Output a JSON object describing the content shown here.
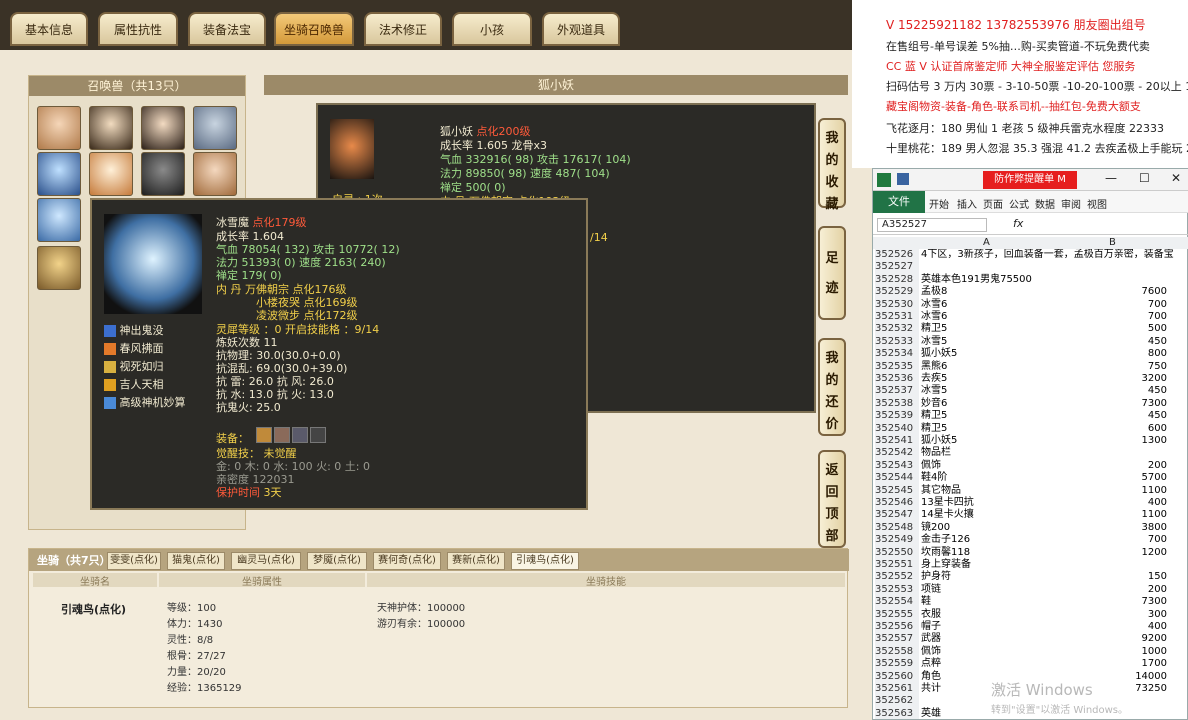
{
  "tabs": [
    {
      "label": "基本信息"
    },
    {
      "label": "属性抗性"
    },
    {
      "label": "装备法宝"
    },
    {
      "label": "坐骑召唤兽"
    },
    {
      "label": "法术修正"
    },
    {
      "label": "小孩"
    },
    {
      "label": "外观道具"
    }
  ],
  "pets_panel": {
    "title": "召唤兽（共13只）"
  },
  "detail_header": {
    "title": "狐小妖"
  },
  "back_card": {
    "name": "狐小妖",
    "name_tag": "点化200级",
    "growth": "成长率 1.605 龙骨x3",
    "hp": "气血 332916( 98) 攻击 17617( 104)",
    "mp": "法力 89850( 98) 速度 487( 104)",
    "ding": "禅定 500( 0)",
    "partial1": "启灵 : 1次",
    "partial2": "内  丹 万佛朝宗 点化192级",
    "partial3": "/14"
  },
  "front_card": {
    "name": "冰雪魔",
    "name_tag": "点化179级",
    "growth": "成长率 1.604",
    "hp": "气血 78054( 132) 攻击 10772( 12)",
    "mp": "法力 51393( 0) 速度 2163( 240)",
    "ding": "禅定 179( 0)",
    "neidan1": "内    丹 万佛朝宗 点化176级",
    "neidan2": "小楼夜哭 点化169级",
    "neidan3": "凌波微步 点化172级",
    "skills": [
      {
        "name": "神出鬼没"
      },
      {
        "name": "春风拂面"
      },
      {
        "name": "视死如归"
      },
      {
        "name": "吉人天相"
      },
      {
        "name": "高级神机妙算"
      }
    ],
    "lingxi": "灵犀等级 ：0 开启技能格 ：9/14",
    "lianyao": "炼妖次数 11",
    "resist1": "抗物理: 30.0(30.0+0.0)",
    "resist2": "抗混乱: 69.0(30.0+39.0)",
    "resist3": "抗    雷: 26.0 抗    风: 26.0",
    "resist4": "抗    水: 13.0 抗    火: 13.0",
    "resist5": "抗鬼火: 25.0",
    "equip_label": "装备：",
    "awake": "觉醒技：  未觉醒",
    "elements": "金: 0 木: 0 水: 100 火: 0 土: 0",
    "intimacy": "亲密度 122031",
    "protect_label": "保护时间",
    "protect_value": "3天"
  },
  "side_buttons": [
    {
      "label": "我的收藏"
    },
    {
      "label": "足迹"
    },
    {
      "label": "我的还价"
    },
    {
      "label": "返回顶部"
    }
  ],
  "mount": {
    "section_label": "坐骑（共7只）",
    "tabs": [
      {
        "label": "雯雯(点化)"
      },
      {
        "label": "猫鬼(点化)"
      },
      {
        "label": "幽灵马(点化)"
      },
      {
        "label": "梦魇(点化)"
      },
      {
        "label": "赛何奇(点化)"
      },
      {
        "label": "赛新(点化)"
      },
      {
        "label": "引魂鸟(点化)"
      }
    ],
    "col_name": "坐骑名",
    "col_attr": "坐骑属性",
    "col_skill": "坐骑技能",
    "name": "引魂鸟(点化)",
    "attrs": [
      {
        "text": "等级：100"
      },
      {
        "text": "体力：1430"
      },
      {
        "text": "灵性：8/8"
      },
      {
        "text": "根骨：27/27"
      },
      {
        "text": "力量：20/20"
      },
      {
        "text": "经验：1365129"
      }
    ],
    "skills": [
      {
        "text": "天神护体：100000"
      },
      {
        "text": "游刃有余：100000"
      }
    ]
  },
  "notepad": {
    "lines": [
      {
        "text": "V 15225921182   13782553976 朋友圈出组号",
        "color": "#e02020"
      },
      {
        "text": "在售组号-单号误差 5%抽…购-买卖管道-不玩免费代卖",
        "color": "#222"
      },
      {
        "text": "CC 蓝 V 认证首席鉴定师 大神全服鉴定评估 您服务",
        "color": "#e02020"
      },
      {
        "text": "扫码估号 3 万内 30票 - 3-10-50票  -10-20-100票 - 20以上 15",
        "color": "#222"
      },
      {
        "text": "藏宝阁物资-装备-角色-联系司机--抽红包-免费大额支",
        "color": "#e02020"
      },
      {
        "text": "飞花逐月：180 男仙 1 老孩 5 级神兵雷克水程度 22333",
        "color": "#222"
      },
      {
        "text": "十里桃花：189 男人忽混 35.3 强混 41.2 去疾孟极上手能玩 2",
        "color": "#222"
      }
    ]
  },
  "excel": {
    "title_banner": "防作弊提醒单 M",
    "ribbon": [
      {
        "label": "文件"
      },
      {
        "label": "开始"
      },
      {
        "label": "插入"
      },
      {
        "label": "页面"
      },
      {
        "label": "公式"
      },
      {
        "label": "数据"
      },
      {
        "label": "审阅"
      },
      {
        "label": "视图"
      }
    ],
    "namebox": "A352527",
    "col_a": "A",
    "col_b": "B",
    "rows": [
      {
        "n": "352526",
        "a": "4下区，3新孩子，回血装备一套，孟极百万亲密，装备宝",
        "b": ""
      },
      {
        "n": "352527",
        "a": "",
        "b": ""
      },
      {
        "n": "352528",
        "a": "英雄本色191男鬼75500",
        "b": ""
      },
      {
        "n": "352529",
        "a": "孟极8",
        "b": "7600"
      },
      {
        "n": "352530",
        "a": "冰雪6",
        "b": "700"
      },
      {
        "n": "352531",
        "a": "冰雪6",
        "b": "700"
      },
      {
        "n": "352532",
        "a": "精卫5",
        "b": "500"
      },
      {
        "n": "352533",
        "a": "冰雪5",
        "b": "450"
      },
      {
        "n": "352534",
        "a": "狐小妖5",
        "b": "800"
      },
      {
        "n": "352535",
        "a": "黑熊6",
        "b": "750"
      },
      {
        "n": "352536",
        "a": "去疾5",
        "b": "3200"
      },
      {
        "n": "352537",
        "a": "冰雪5",
        "b": "450"
      },
      {
        "n": "352538",
        "a": "妙音6",
        "b": "7300"
      },
      {
        "n": "352539",
        "a": "精卫5",
        "b": "450"
      },
      {
        "n": "352540",
        "a": "精卫5",
        "b": "600"
      },
      {
        "n": "352541",
        "a": "狐小妖5",
        "b": "1300"
      },
      {
        "n": "352542",
        "a": "物品栏",
        "b": ""
      },
      {
        "n": "352543",
        "a": "佩饰",
        "b": "200"
      },
      {
        "n": "352544",
        "a": "鞋4阶",
        "b": "5700"
      },
      {
        "n": "352545",
        "a": "其它物品",
        "b": "1100"
      },
      {
        "n": "352546",
        "a": "13星卡四抗",
        "b": "400"
      },
      {
        "n": "352547",
        "a": "14星卡火攘",
        "b": "1100"
      },
      {
        "n": "352548",
        "a": "镜200",
        "b": "3800"
      },
      {
        "n": "352549",
        "a": "金击子126",
        "b": "700"
      },
      {
        "n": "352550",
        "a": "坎雨馨118",
        "b": "1200"
      },
      {
        "n": "352551",
        "a": "身上穿装备",
        "b": ""
      },
      {
        "n": "352552",
        "a": "护身符",
        "b": "150"
      },
      {
        "n": "352553",
        "a": "项链",
        "b": "200"
      },
      {
        "n": "352554",
        "a": "鞋",
        "b": "7300"
      },
      {
        "n": "352555",
        "a": "衣服",
        "b": "300"
      },
      {
        "n": "352556",
        "a": "帽子",
        "b": "400"
      },
      {
        "n": "352557",
        "a": "武器",
        "b": "9200"
      },
      {
        "n": "352558",
        "a": "佩饰",
        "b": "1000"
      },
      {
        "n": "352559",
        "a": "点粹",
        "b": "1700"
      },
      {
        "n": "352560",
        "a": "角色",
        "b": "14000"
      },
      {
        "n": "352561",
        "a": "共计",
        "b": "73250"
      },
      {
        "n": "352562",
        "a": "",
        "b": ""
      },
      {
        "n": "352563",
        "a": "英雄",
        "b": ""
      }
    ],
    "watermark1": "激活 Windows",
    "watermark2": "转到\"设置\"以激活 Windows。"
  }
}
